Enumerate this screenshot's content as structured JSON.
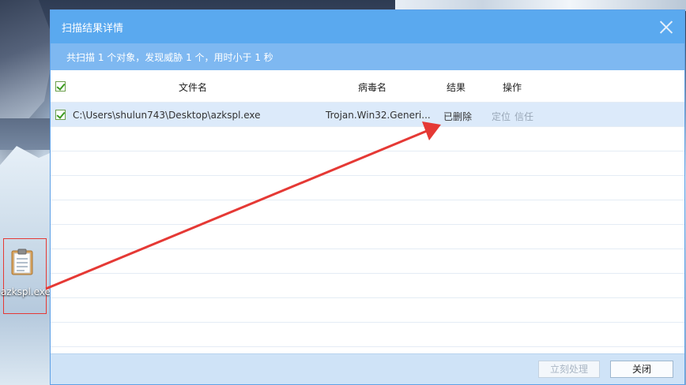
{
  "dialog": {
    "title": "扫描结果详情",
    "summary": "共扫描 1 个对象，发现威胁 1 个，用时小于 1 秒"
  },
  "table": {
    "columns": [
      "文件名",
      "病毒名",
      "结果",
      "操作"
    ],
    "rows": [
      {
        "checked": true,
        "file": "C:\\Users\\shulun743\\Desktop\\azkspl.exe",
        "virus": "Trojan.Win32.Generi...",
        "result": "已删除",
        "actions": [
          "定位",
          "信任"
        ]
      }
    ],
    "empty_rows": 9
  },
  "footer": {
    "process_button": "立刻处理",
    "close_button": "关闭"
  },
  "desktop": {
    "icon_label": "azkspl.exe"
  },
  "colors": {
    "title_bar": "#5aa9ef",
    "summary_bar": "#7eb8f1",
    "selected_row": "#dceafa",
    "annotation": "#e53935"
  }
}
